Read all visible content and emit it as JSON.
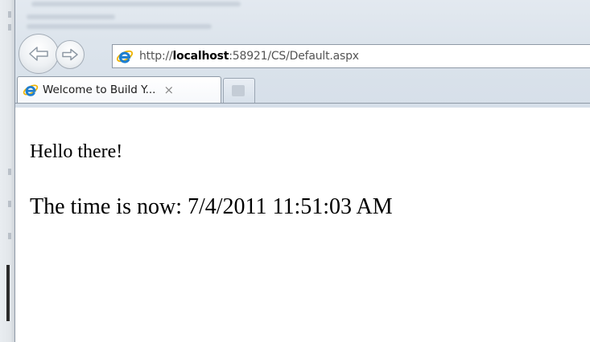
{
  "browser": {
    "address_bar": {
      "url_prefix": "http://",
      "url_host": "localhost",
      "url_rest": ":58921/CS/Default.aspx"
    },
    "tabs": [
      {
        "title": "Welcome to Build Y...",
        "close_glyph": "×",
        "icon": "ie-icon",
        "active": true
      }
    ],
    "new_tab_icon": "new-tab-icon",
    "back_icon": "back-arrow-icon",
    "forward_icon": "forward-arrow-icon",
    "colors": {
      "chrome": "#dce4ec",
      "ie_blue": "#1e7fd0",
      "ie_gold": "#f0b400"
    }
  },
  "page": {
    "greeting": "Hello there!",
    "time_label": "The time is now:",
    "time_value": "7/4/2011 11:51:03 AM"
  }
}
